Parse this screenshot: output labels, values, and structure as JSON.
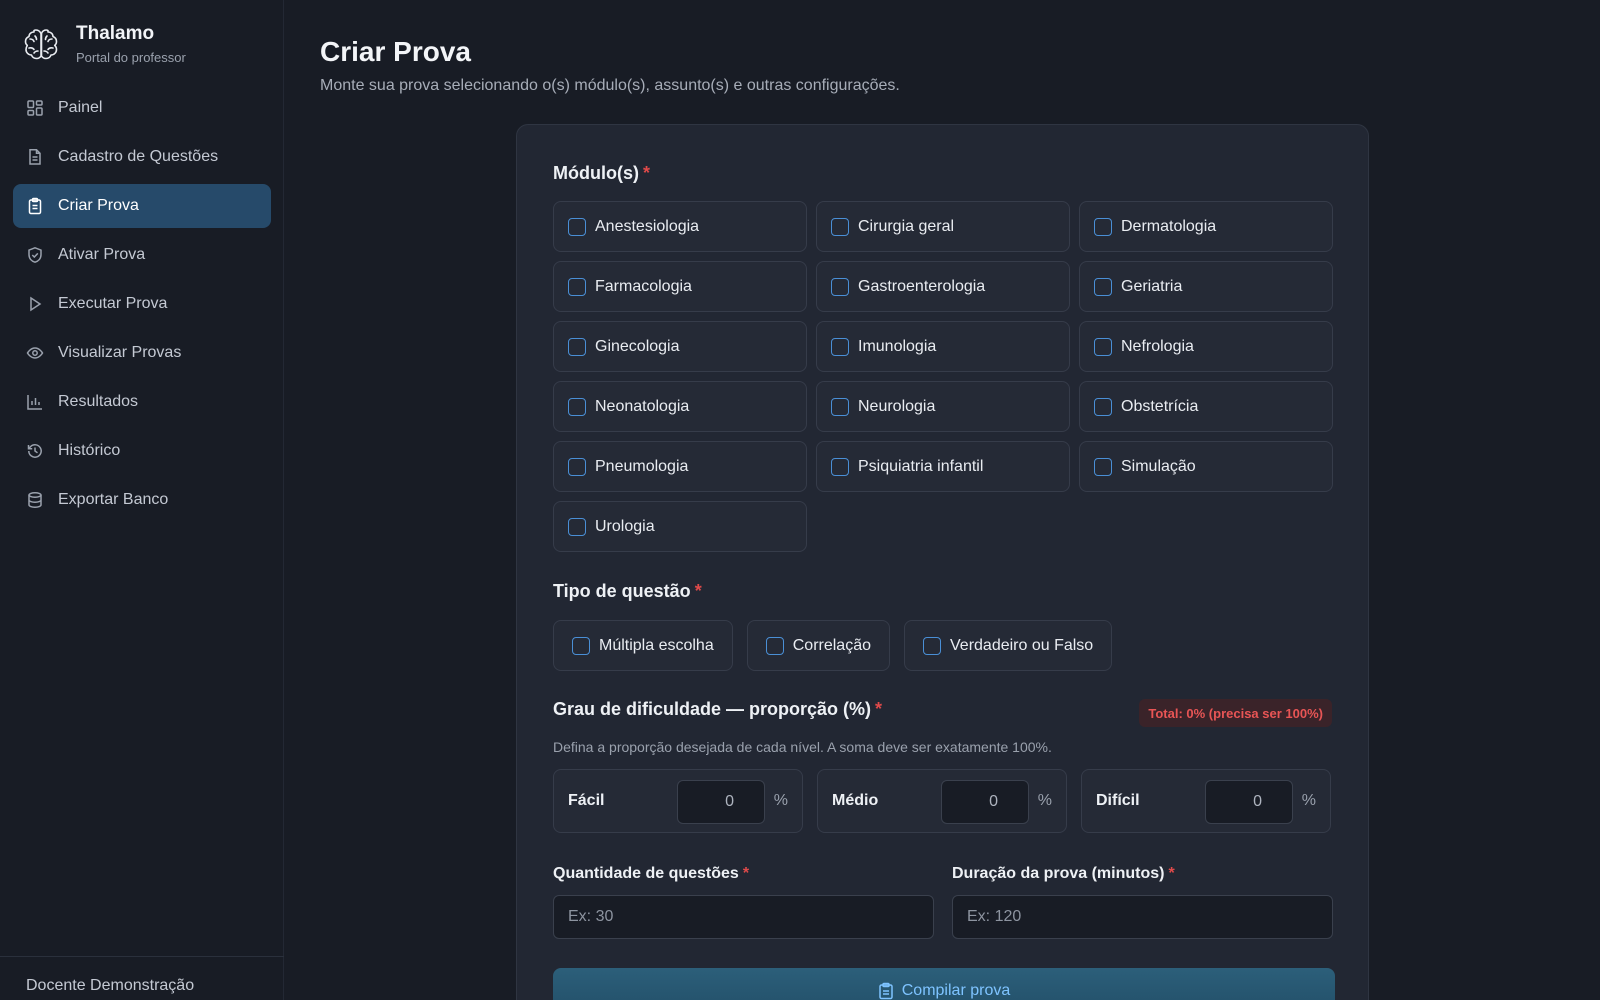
{
  "brand": {
    "name": "Thalamo",
    "subtitle": "Portal do professor"
  },
  "sidebar": {
    "items": [
      {
        "label": "Painel",
        "icon": "dashboard-icon",
        "active": false
      },
      {
        "label": "Cadastro de Questões",
        "icon": "document-icon",
        "active": false
      },
      {
        "label": "Criar Prova",
        "icon": "clipboard-icon",
        "active": true
      },
      {
        "label": "Ativar Prova",
        "icon": "shield-icon",
        "active": false
      },
      {
        "label": "Executar Prova",
        "icon": "play-icon",
        "active": false
      },
      {
        "label": "Visualizar Provas",
        "icon": "eye-icon",
        "active": false
      },
      {
        "label": "Resultados",
        "icon": "bar-chart-icon",
        "active": false
      },
      {
        "label": "Histórico",
        "icon": "history-icon",
        "active": false
      },
      {
        "label": "Exportar Banco",
        "icon": "database-icon",
        "active": false
      }
    ],
    "footer_user": "Docente Demonstração"
  },
  "page": {
    "title": "Criar Prova",
    "subtitle": "Monte sua prova selecionando o(s) módulo(s), assunto(s) e outras configurações."
  },
  "modules": {
    "label": "Módulo(s)",
    "required_mark": "*",
    "options": [
      "Anestesiologia",
      "Cirurgia geral",
      "Dermatologia",
      "Farmacologia",
      "Gastroenterologia",
      "Geriatria",
      "Ginecologia",
      "Imunologia",
      "Nefrologia",
      "Neonatologia",
      "Neurologia",
      "Obstetrícia",
      "Pneumologia",
      "Psiquiatria infantil",
      "Simulação",
      "Urologia"
    ]
  },
  "question_type": {
    "label": "Tipo de questão",
    "required_mark": "*",
    "options": [
      "Múltipla escolha",
      "Correlação",
      "Verdadeiro ou Falso"
    ]
  },
  "difficulty": {
    "label": "Grau de dificuldade — proporção (%)",
    "required_mark": "*",
    "total_badge": "Total: 0% (precisa ser 100%)",
    "help": "Defina a proporção desejada de cada nível. A soma deve ser exatamente 100%.",
    "levels": [
      {
        "name": "Fácil",
        "value": "0",
        "unit": "%"
      },
      {
        "name": "Médio",
        "value": "0",
        "unit": "%"
      },
      {
        "name": "Difícil",
        "value": "0",
        "unit": "%"
      }
    ]
  },
  "quantity": {
    "label": "Quantidade de questões",
    "required_mark": "*",
    "placeholder": "Ex: 30"
  },
  "duration": {
    "label": "Duração da prova (minutos)",
    "required_mark": "*",
    "placeholder": "Ex: 120"
  },
  "compile_button": {
    "label": "Compilar prova"
  },
  "colors": {
    "accent": "#4a8fd6",
    "active_nav": "#264a6a",
    "error": "#e04a4a",
    "background": "#181c25",
    "card": "#222733"
  }
}
